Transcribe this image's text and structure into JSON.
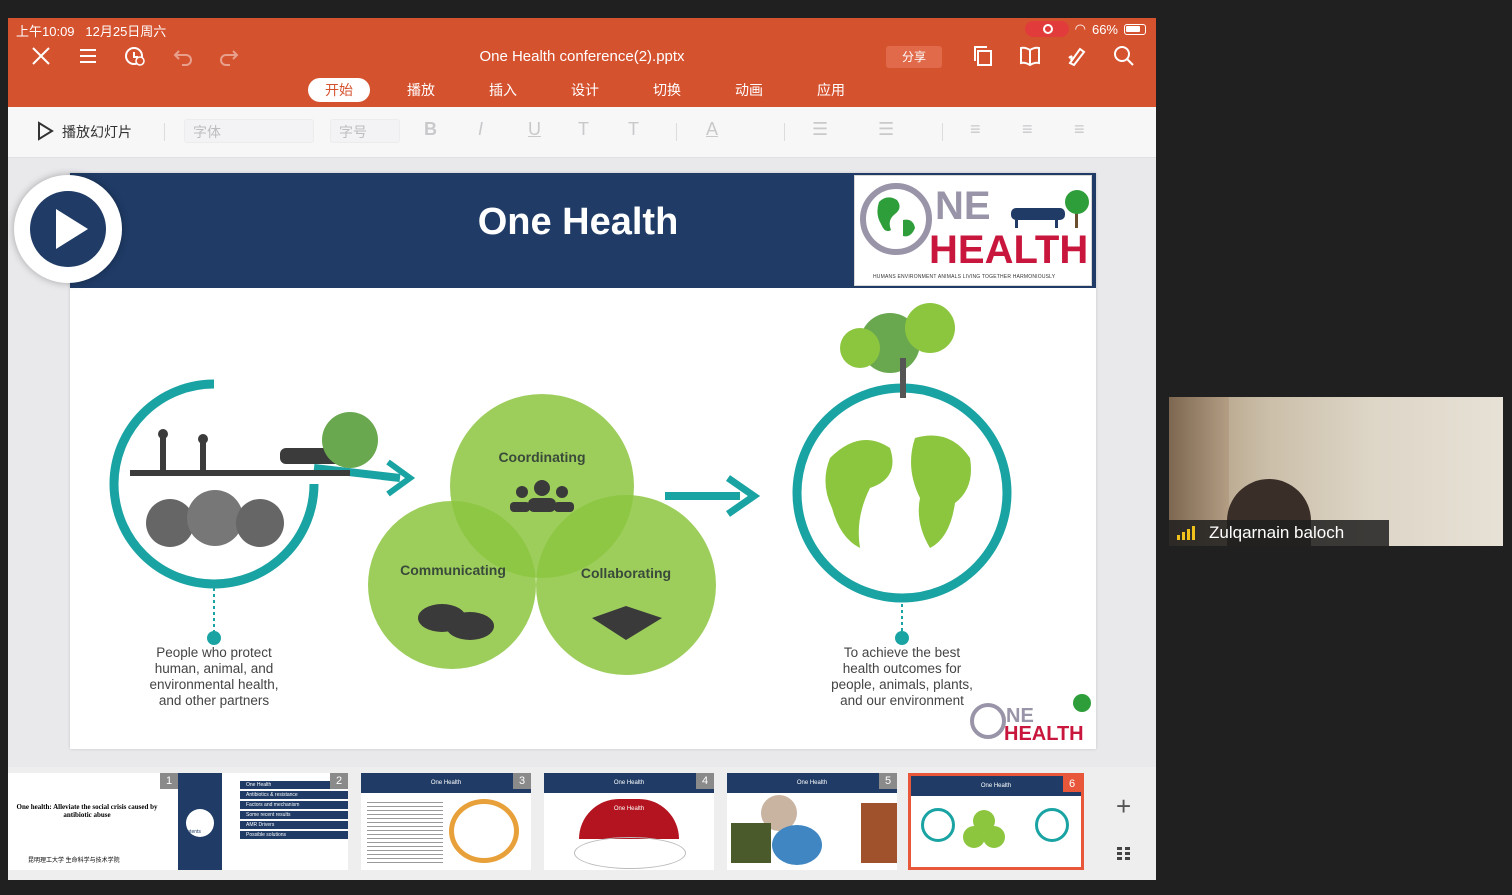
{
  "status": {
    "time": "上午10:09",
    "date": "12月25日周六",
    "battery": "66%"
  },
  "window": {
    "file_title": "One Health conference(2).pptx",
    "share_label": "分享"
  },
  "tabs": [
    {
      "label": "开始",
      "active": true
    },
    {
      "label": "播放"
    },
    {
      "label": "插入"
    },
    {
      "label": "设计"
    },
    {
      "label": "切换"
    },
    {
      "label": "动画"
    },
    {
      "label": "应用"
    }
  ],
  "toolbar": {
    "play_label": "播放幻灯片",
    "font_placeholder": "字体",
    "size_placeholder": "字号",
    "bold": "B",
    "italic": "I",
    "underline": "U",
    "superscript": "T",
    "subscript": "T",
    "font_color": "A"
  },
  "slide": {
    "title": "One Health",
    "logo": {
      "line1": "NE",
      "line2": "HEALTH",
      "tagline": "HUMANS ENVIRONMENT ANIMALS LIVING TOGETHER HARMONIOUSLY"
    },
    "bubbles": {
      "top": "Coordinating",
      "left": "Communicating",
      "right": "Collaborating"
    },
    "left_caption": [
      "People who protect",
      "human, animal, and",
      "environmental health,",
      "and other partners"
    ],
    "right_caption": [
      "To achieve the best",
      "health outcomes for",
      "people, animals, plants,",
      "and our environment"
    ],
    "footer_logo": {
      "line1": "NE",
      "line2": "HEALTH"
    }
  },
  "thumbnails": [
    {
      "number": "1",
      "title": "One health: Alleviate the social crisis caused by antibiotic abuse",
      "footer": "昆明理工大学 生命科学与技术学院"
    },
    {
      "number": "2",
      "items": [
        "One Health",
        "Antibiotics & resistance",
        "Factors and mechanism",
        "Some recent results",
        "AMR Drivers",
        "Possible solutions"
      ],
      "side_label": "contents"
    },
    {
      "number": "3",
      "title": "One Health"
    },
    {
      "number": "4",
      "title": "One Health",
      "arch_label": "One Health"
    },
    {
      "number": "5",
      "title": "One Health"
    },
    {
      "number": "6",
      "title": "One Health",
      "selected": true
    }
  ],
  "participant": {
    "name": "Zulqarnain baloch"
  },
  "colors": {
    "accent": "#d5522f",
    "slide_header": "#1f3b66",
    "teal": "#1aa3a3",
    "green": "#8cc63f"
  }
}
